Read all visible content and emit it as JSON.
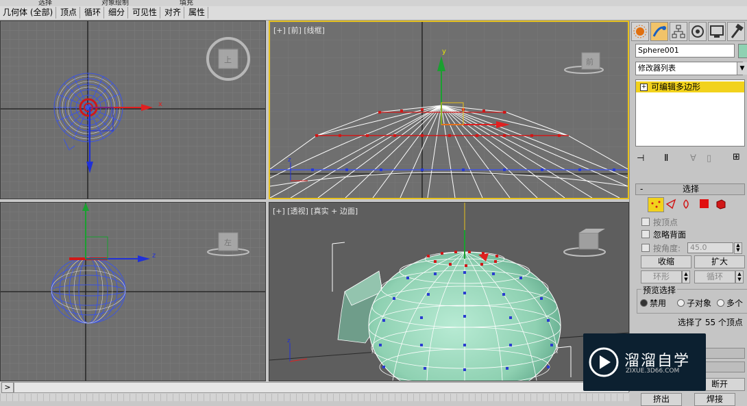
{
  "ribbon": [
    "选择",
    "对象绘制",
    "填充"
  ],
  "toolbar": {
    "items": [
      "几何体 (全部)",
      "顶点",
      "循环",
      "细分",
      "可见性",
      "对齐",
      "属性"
    ]
  },
  "viewports": {
    "top_left": {
      "label": ""
    },
    "front": {
      "label": "[+] [前] [线框]",
      "cube_label": "前"
    },
    "left": {
      "label": "",
      "cube_label": "左"
    },
    "perspective": {
      "label": "[+] [透视] [真实 + 边面]"
    },
    "top_cube_label": "上"
  },
  "panel": {
    "object_name": "Sphere001",
    "modifier_list": "修改器列表",
    "stack_item": "可编辑多边形",
    "selection_header": "选择",
    "by_vertex": "按顶点",
    "ignore_backface": "忽略背面",
    "by_angle": "按角度:",
    "angle_value": "45.0",
    "shrink": "收缩",
    "grow": "扩大",
    "ring": "环形",
    "loop": "循环",
    "preview_label": "预览选择",
    "preview_disabled": "禁用",
    "preview_subobj": "子对象",
    "preview_multi": "多个",
    "status": "选择了 55 个顶点",
    "break": "断开",
    "extrude": "挤出",
    "weld": "焊接"
  },
  "bottom": {
    "arrow": ">"
  },
  "watermark": {
    "title": "溜溜自学",
    "url": "ZIXUE.3D66.COM"
  },
  "axis": {
    "x": "x",
    "y": "y",
    "z": "z"
  },
  "colors": {
    "accent": "#e8c21c",
    "sphere": "#8fd1b2",
    "wire": "#ffffff",
    "vertex_sel": "#d01818",
    "vertex": "#2a3cd0"
  }
}
